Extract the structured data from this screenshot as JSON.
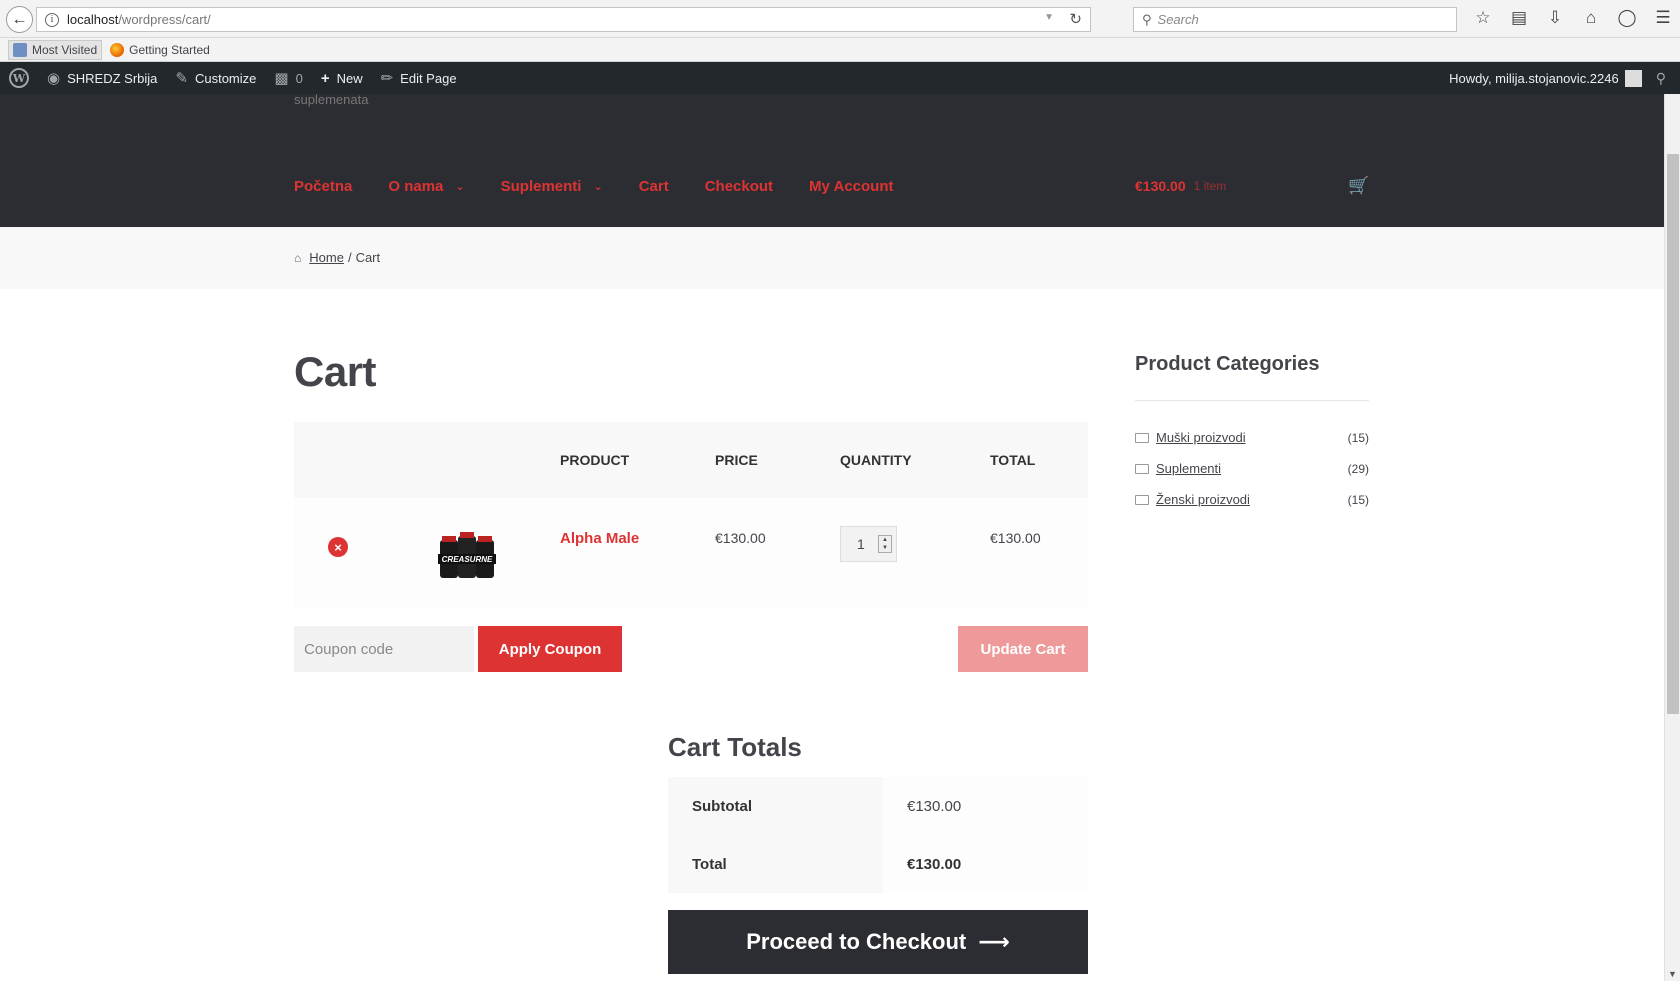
{
  "browser": {
    "url_host": "localhost",
    "url_path": "/wordpress/cart/",
    "search_placeholder": "Search",
    "bookmarks": [
      {
        "label": "Most Visited"
      },
      {
        "label": "Getting Started"
      }
    ]
  },
  "admin_bar": {
    "site_name": "SHREDZ Srbija",
    "customize": "Customize",
    "comments_count": "0",
    "new_label": "New",
    "edit_page": "Edit Page",
    "greeting": "Howdy, milija.stojanovic.2246"
  },
  "header": {
    "tagline": "suplemenata",
    "nav": [
      {
        "label": "Početna",
        "dropdown": false
      },
      {
        "label": "O nama",
        "dropdown": true
      },
      {
        "label": "Suplementi",
        "dropdown": true
      },
      {
        "label": "Cart",
        "dropdown": false
      },
      {
        "label": "Checkout",
        "dropdown": false
      },
      {
        "label": "My Account",
        "dropdown": false
      }
    ],
    "cart_amount": "€130.00",
    "cart_count": "1 item"
  },
  "breadcrumb": {
    "home": "Home",
    "separator": "/",
    "current": "Cart"
  },
  "page": {
    "title": "Cart"
  },
  "cart": {
    "headers": {
      "product": "PRODUCT",
      "price": "PRICE",
      "quantity": "QUANTITY",
      "total": "TOTAL"
    },
    "items": [
      {
        "name": "Alpha Male",
        "price": "€130.00",
        "quantity": "1",
        "total": "€130.00",
        "image_text": "CREASURNE"
      }
    ],
    "coupon_placeholder": "Coupon code",
    "apply_coupon": "Apply Coupon",
    "update_cart": "Update Cart"
  },
  "totals": {
    "title": "Cart Totals",
    "subtotal_label": "Subtotal",
    "subtotal_value": "€130.00",
    "total_label": "Total",
    "total_value": "€130.00",
    "checkout_label": "Proceed to Checkout"
  },
  "sidebar": {
    "title": "Product Categories",
    "categories": [
      {
        "name": "Muški proizvodi",
        "count": "(15)"
      },
      {
        "name": "Suplementi",
        "count": "(29)"
      },
      {
        "name": "Ženski proizvodi",
        "count": "(15)"
      }
    ]
  },
  "colors": {
    "accent": "#dd3333",
    "header_bg": "#2c2d33",
    "admin_bar_bg": "#23282d"
  }
}
